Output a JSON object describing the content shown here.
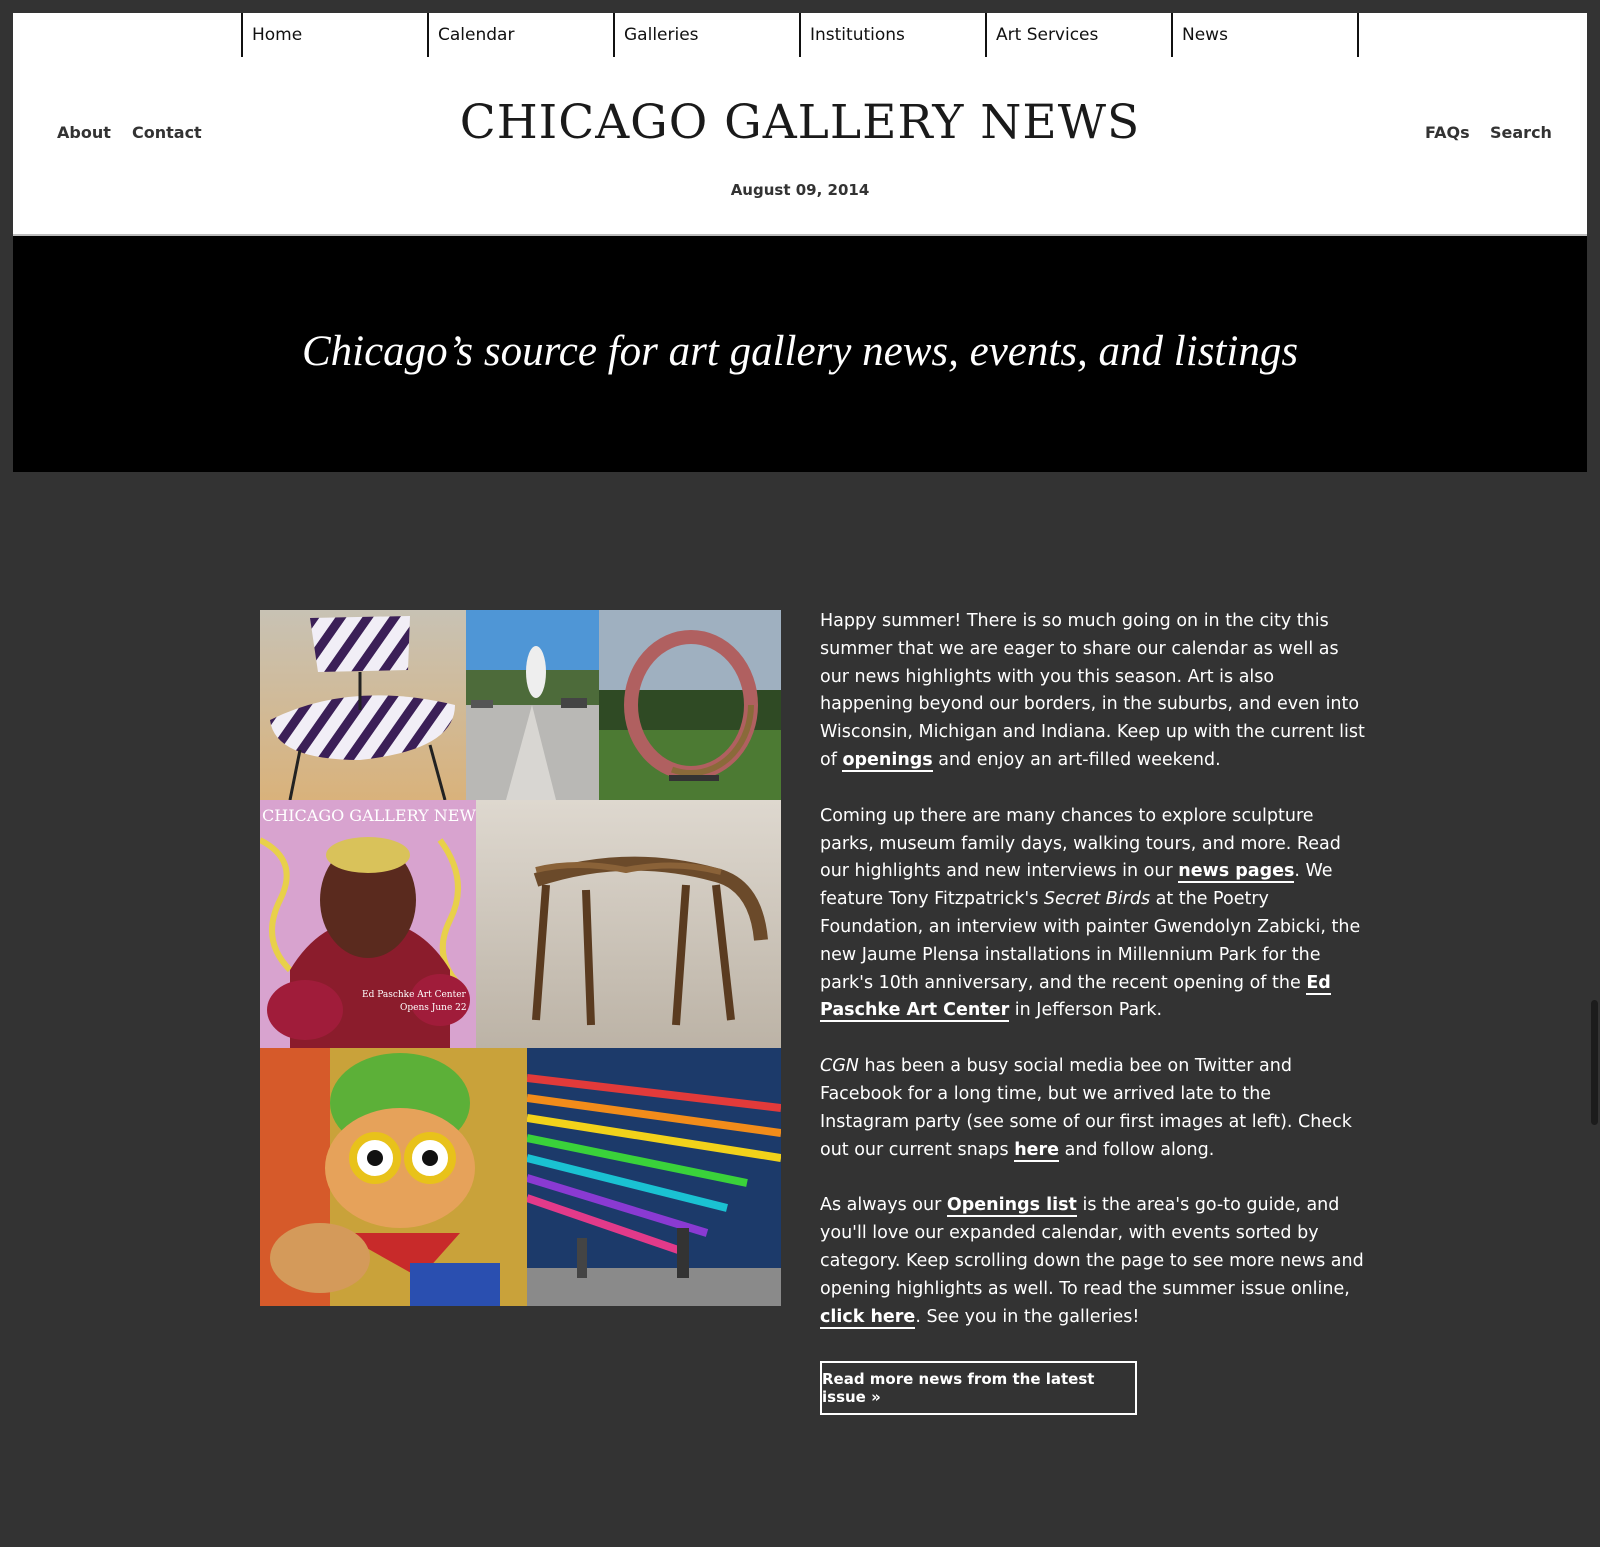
{
  "nav": {
    "items": [
      {
        "label": "Home"
      },
      {
        "label": "Calendar"
      },
      {
        "label": "Galleries"
      },
      {
        "label": "Institutions"
      },
      {
        "label": "Art Services"
      },
      {
        "label": "News"
      }
    ]
  },
  "header": {
    "left_links": {
      "about": "About",
      "contact": "Contact"
    },
    "right_links": {
      "faqs": "FAQs",
      "search": "Search"
    },
    "title": "CHICAGO GALLERY NEWS",
    "date": "August 09, 2014"
  },
  "hero": {
    "tagline": "Chicago’s source for art gallery news, events, and listings"
  },
  "collage": {
    "cover_masthead": "CHICAGO GALLERY NEWS",
    "cover_line1": "Ed Paschke Art Center",
    "cover_line2": "Opens June 22"
  },
  "article": {
    "p1": {
      "text1": "Happy summer! There is so much going on in the city this summer that we are eager to share our calendar as well as our news highlights with you this season.  Art is also happening beyond our borders, in the suburbs, and even into Wisconsin, Michigan and Indiana. Keep up with the current list of ",
      "link1": "openings",
      "text2": " and enjoy an art-filled weekend."
    },
    "p2": {
      "text1": "Coming up there are many chances to explore sculpture parks, museum family days, walking tours, and more. Read our highlights and new interviews in our ",
      "link1": "news pages",
      "text2": ". We feature Tony Fitzpatrick's ",
      "italic1": "Secret Birds",
      "text3": " at the Poetry Foundation, an interview with painter Gwendolyn Zabicki, the new Jaume Plensa installations in Millennium Park for the park's 10th anniversary, and the recent opening of the ",
      "link2": "Ed Paschke Art Center",
      "text4": " in Jefferson Park."
    },
    "p3": {
      "italic1": "CGN",
      "text1": " has been a busy social media bee on Twitter and Facebook for a long time, but we arrived late to the Instagram party (see some of our first images at left). Check out our current snaps ",
      "link1": "here",
      "text2": " and follow along."
    },
    "p4": {
      "text1": "As always our ",
      "link1": "Openings list",
      "text2": " is the area's go-to guide, and you'll love our expanded calendar, with events sorted by category. Keep scrolling down the page to see more news and opening highlights as well. To read the summer issue online, ",
      "link2": "click here",
      "text3": ". See you in the galleries!"
    },
    "read_more": "Read more news from the latest issue »"
  },
  "colors": {
    "page_bg": "#333333",
    "header_bg": "#ffffff",
    "hero_bg": "#000000",
    "text_light": "#ffffff"
  }
}
